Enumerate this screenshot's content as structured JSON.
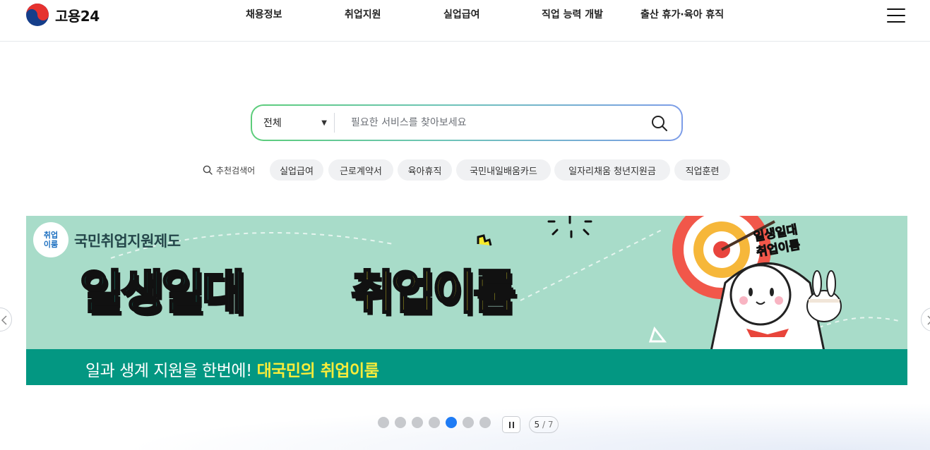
{
  "header": {
    "logo_text": "고용24",
    "nav": [
      "채용정보",
      "취업지원",
      "실업급여",
      "직업 능력 개발",
      "출산 휴가·육아 휴직"
    ]
  },
  "search": {
    "scope_value": "전체",
    "placeholder": "필요한 서비스를 찾아보세요"
  },
  "recommended": {
    "label": "추천검색어",
    "keywords": [
      "실업급여",
      "근로계약서",
      "육아휴직",
      "국민내일배움카드",
      "일자리채움 청년지원금",
      "직업훈련"
    ]
  },
  "banner": {
    "badge_line1": "취업",
    "badge_line2": "이룸",
    "program": "국민취업지원제도",
    "title_left": "일생일대",
    "title_right": "취업이룸",
    "subtitle_plain": "일과 생계 지원을 한번에!",
    "subtitle_highlight": "대국민의 취업이룸",
    "tag_line1": "일생일대",
    "tag_line2": "취업이룸"
  },
  "pagination": {
    "current": "5",
    "total": "7",
    "separator": "/",
    "count": 7,
    "active_index": 4
  },
  "colors": {
    "active_dot": "#1f7cf5",
    "banner_bg": "#a8dcc9",
    "banner_strip": "#039782"
  }
}
